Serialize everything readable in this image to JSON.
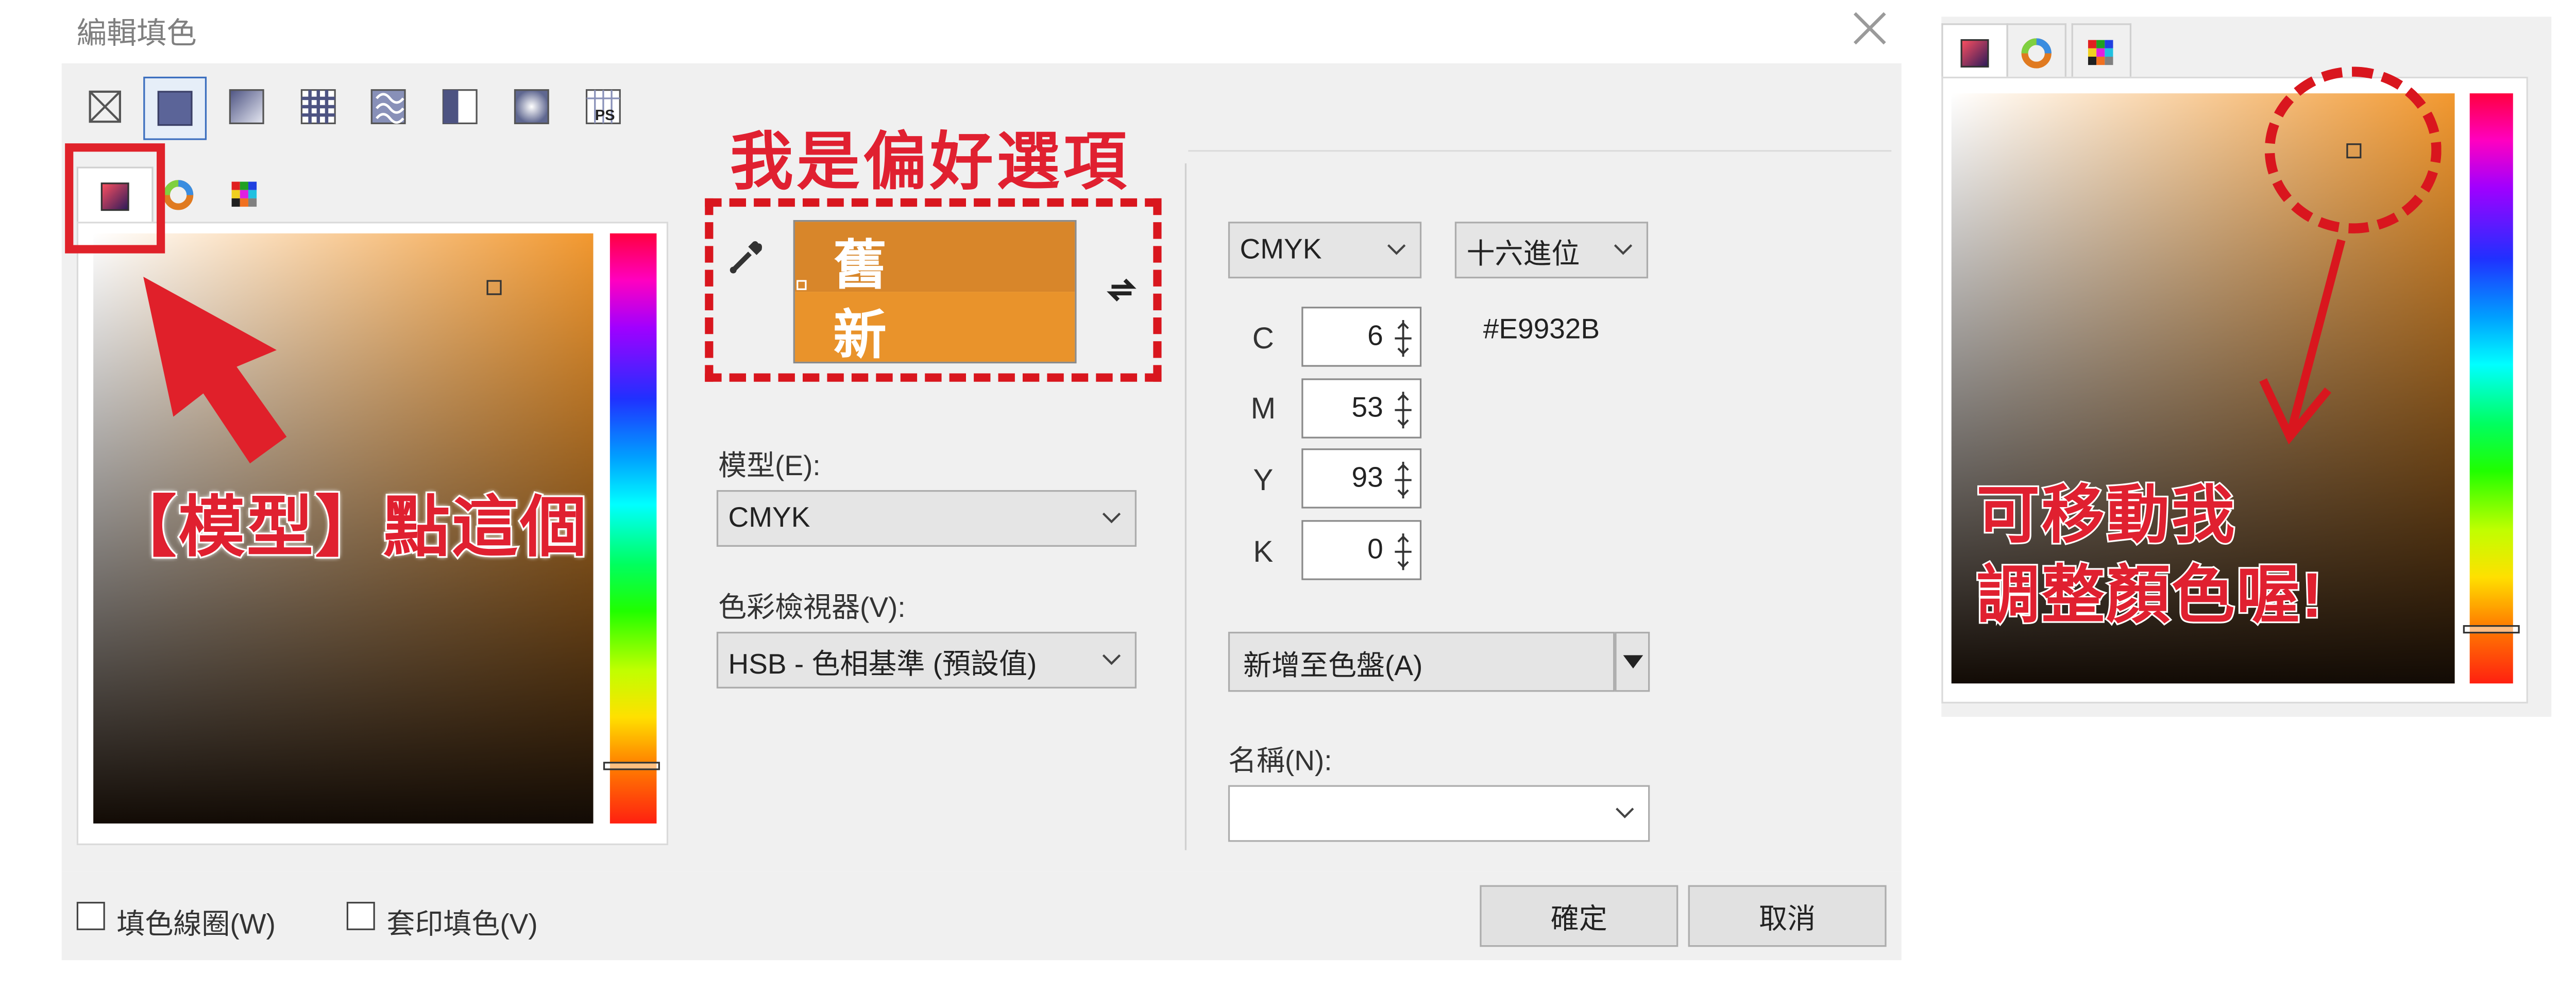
{
  "dialog": {
    "title": "編輯填色"
  },
  "fill_types": [
    "no-fill-icon",
    "uniform-fill-icon",
    "fountain-fill-icon",
    "vector-pattern-icon",
    "bitmap-pattern-icon",
    "two-color-pattern-icon",
    "texture-fill-icon",
    "postscript-fill-icon"
  ],
  "viewer_tabs": [
    "color-viewers-tab",
    "color-harmonies-tab",
    "color-palettes-tab"
  ],
  "annotations": {
    "top": "我是偏好選項",
    "left": "【模型】點這個",
    "right_line1": "可移動我",
    "right_line2": "調整顏色喔!"
  },
  "swatches": {
    "old_label": "舊",
    "new_label": "新",
    "old_color": "#D8862A",
    "new_color": "#E9932B"
  },
  "model": {
    "label": "模型(E):",
    "value": "CMYK"
  },
  "viewer": {
    "label": "色彩檢視器(V):",
    "value": "HSB - 色相基準 (預設值)"
  },
  "values_model": {
    "value": "CMYK"
  },
  "hex_format": {
    "value": "十六進位"
  },
  "hex_value": "#E9932B",
  "cmyk": [
    {
      "label": "C",
      "value": "6"
    },
    {
      "label": "M",
      "value": "53"
    },
    {
      "label": "Y",
      "value": "93"
    },
    {
      "label": "K",
      "value": "0"
    }
  ],
  "add_to_palette": {
    "label": "新增至色盤(A)"
  },
  "name": {
    "label": "名稱(N):",
    "value": ""
  },
  "footer": {
    "wireframe_label": "填色線圈(W)",
    "overprint_label": "套印填色(V)",
    "ok_label": "確定",
    "cancel_label": "取消"
  },
  "colors": {
    "accent": "#3C6FBF",
    "annotation_red": "#E0202A",
    "hue_position": 0.91
  }
}
